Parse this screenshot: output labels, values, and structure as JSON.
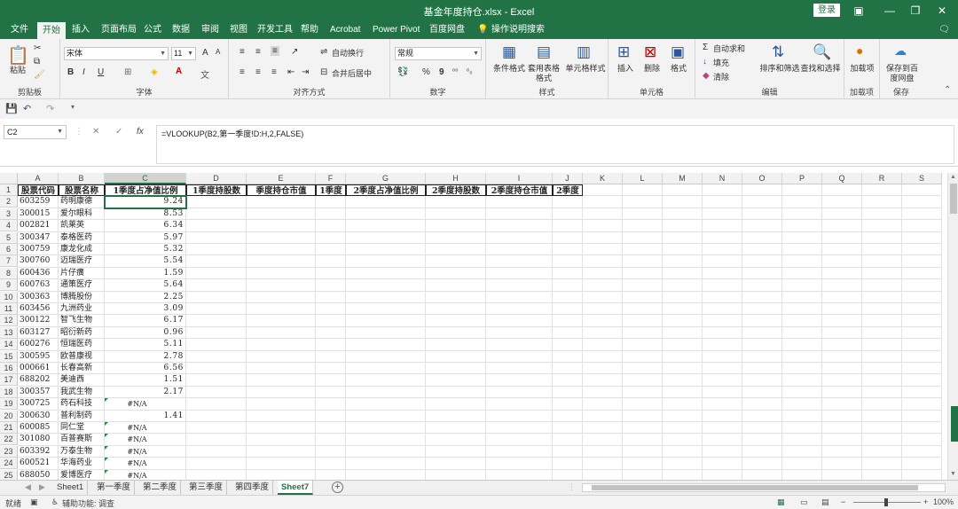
{
  "window": {
    "title": "基金年度持仓.xlsx  -  Excel",
    "login": "登录",
    "controls": [
      "▣",
      "—",
      "❐",
      "✕"
    ]
  },
  "menu_tabs": [
    "文件",
    "开始",
    "插入",
    "页面布局",
    "公式",
    "数据",
    "审阅",
    "视图",
    "开发工具",
    "帮助",
    "Acrobat",
    "Power Pivot",
    "百度网盘",
    "操作说明搜索"
  ],
  "active_tab": "开始",
  "ribbon": {
    "clipboard": {
      "paste": "粘贴",
      "label": "剪贴板"
    },
    "font": {
      "name": "宋体",
      "size": "11",
      "label": "字体",
      "bold": "B",
      "italic": "I",
      "underline": "U",
      "grow": "A",
      "shrink": "A",
      "color": "A"
    },
    "alignment": {
      "wrap": "自动换行",
      "merge": "合并后居中",
      "label": "对齐方式"
    },
    "number": {
      "format": "常规",
      "percent": "%",
      "comma": "9",
      "label": "数字"
    },
    "styles": {
      "conditional": "条件格式",
      "table": "套用表格格式",
      "cell": "单元格样式",
      "label": "样式"
    },
    "cells": {
      "insert": "插入",
      "delete": "删除",
      "format": "格式",
      "label": "单元格"
    },
    "editing": {
      "autosum": "自动求和",
      "fill": "填充",
      "clear": "清除",
      "sort": "排序和筛选",
      "find": "查找和选择",
      "label": "编辑"
    },
    "addins": {
      "addin": "加载项",
      "label": "加载项"
    },
    "save": {
      "baidu": "保存到百度网盘",
      "label": "保存"
    }
  },
  "formula_bar": {
    "name_box": "C2",
    "formula": "=VLOOKUP(B2,第一季度!D:H,2,FALSE)"
  },
  "columns": [
    "A",
    "B",
    "C",
    "D",
    "E",
    "F",
    "G",
    "H",
    "I",
    "J",
    "K",
    "L",
    "M",
    "N",
    "O",
    "P",
    "Q",
    "R",
    "S"
  ],
  "selected_column": "C",
  "header_row": [
    "股票代码",
    "股票名称",
    "1季度占净值比例",
    "1季度持股数",
    "季度持仓市值",
    "1季度",
    "2季度占净值比例",
    "2季度持股数",
    "2季度持仓市值",
    "2季度"
  ],
  "rows": [
    [
      "603259",
      "药明康德",
      "9.24"
    ],
    [
      "300015",
      "爱尔眼科",
      "8.53"
    ],
    [
      "002821",
      "凯莱英",
      "6.34"
    ],
    [
      "300347",
      "泰格医药",
      "5.97"
    ],
    [
      "300759",
      "康龙化成",
      "5.32"
    ],
    [
      "300760",
      "迈瑞医疗",
      "5.54"
    ],
    [
      "600436",
      "片仔癀",
      "1.59"
    ],
    [
      "600763",
      "通策医疗",
      "5.64"
    ],
    [
      "300363",
      "博腾股份",
      "2.25"
    ],
    [
      "603456",
      "九洲药业",
      "3.09"
    ],
    [
      "300122",
      "智飞生物",
      "6.17"
    ],
    [
      "603127",
      "昭衍新药",
      "0.96"
    ],
    [
      "600276",
      "恒瑞医药",
      "5.11"
    ],
    [
      "300595",
      "欧普康视",
      "2.78"
    ],
    [
      "000661",
      "长春高新",
      "6.56"
    ],
    [
      "688202",
      "美迪西",
      "1.51"
    ],
    [
      "300357",
      "我武生物",
      "2.17"
    ],
    [
      "300725",
      "药石科技",
      "#N/A"
    ],
    [
      "300630",
      "普利制药",
      "1.41"
    ],
    [
      "600085",
      "同仁堂",
      "#N/A"
    ],
    [
      "301080",
      "百普赛斯",
      "#N/A"
    ],
    [
      "603392",
      "万泰生物",
      "#N/A"
    ],
    [
      "600521",
      "华海药业",
      "#N/A"
    ],
    [
      "688050",
      "爱博医疗",
      "#N/A"
    ]
  ],
  "sheets": [
    "Sheet1",
    "第一季度",
    "第二季度",
    "第三季度",
    "第四季度",
    "Sheet7"
  ],
  "active_sheet": "Sheet7",
  "status": {
    "mode": "就绪",
    "accessibility": "辅助功能: 调查",
    "zoom": "100%"
  }
}
